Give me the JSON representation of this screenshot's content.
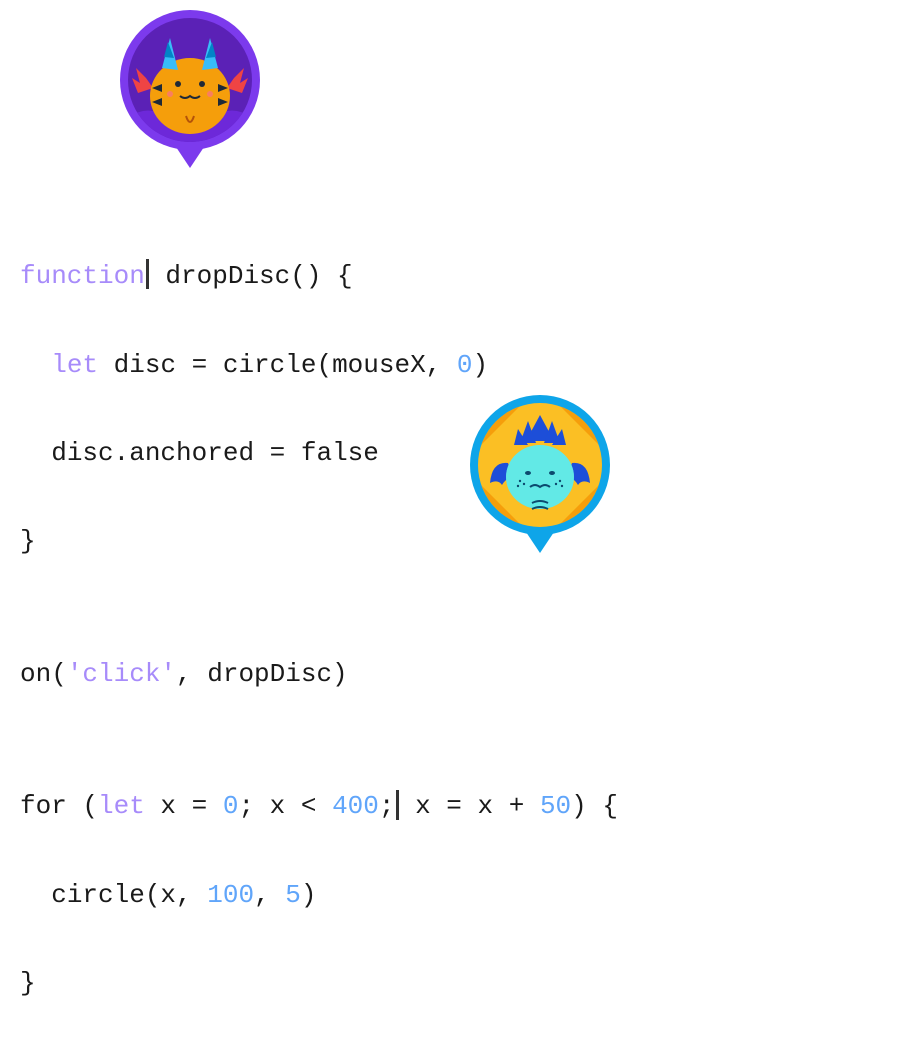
{
  "avatars": {
    "user1": {
      "color_ring": "#7c3aed",
      "character": "orange-horned-cat",
      "position_desc": "after function keyword line 1"
    },
    "user2": {
      "color_ring": "#0ea5e9",
      "character": "blue-fish-sprite",
      "position_desc": "after 400; in for loop"
    }
  },
  "code": {
    "l1_function": "function",
    "l1_rest": " dropDisc() {",
    "l2_indent": "  ",
    "l2_let": "let",
    "l2_rest1": " disc = circle(mouseX, ",
    "l2_num0": "0",
    "l2_rest2": ")",
    "l3_indent": "  ",
    "l3_rest": "disc.anchored = false",
    "l4": "}",
    "l5": "",
    "l6_a": "on(",
    "l6_str": "'click'",
    "l6_b": ", dropDisc)",
    "l7": "",
    "l8_a": "for (",
    "l8_let": "let",
    "l8_b": " x = ",
    "l8_n0": "0",
    "l8_c": "; x < ",
    "l8_n400": "400",
    "l8_d": ";",
    "l8_e": " x = x + ",
    "l8_n50": "50",
    "l8_f": ") {",
    "l9_indent": "  ",
    "l9_a": "circle(x, ",
    "l9_n100": "100",
    "l9_b": ", ",
    "l9_n5": "5",
    "l9_c": ")",
    "l10": "}"
  },
  "syntax_colors": {
    "keyword": "#a78bfa",
    "string": "#a78bfa",
    "number": "#60a5fa",
    "plain": "#1a1a1a"
  }
}
